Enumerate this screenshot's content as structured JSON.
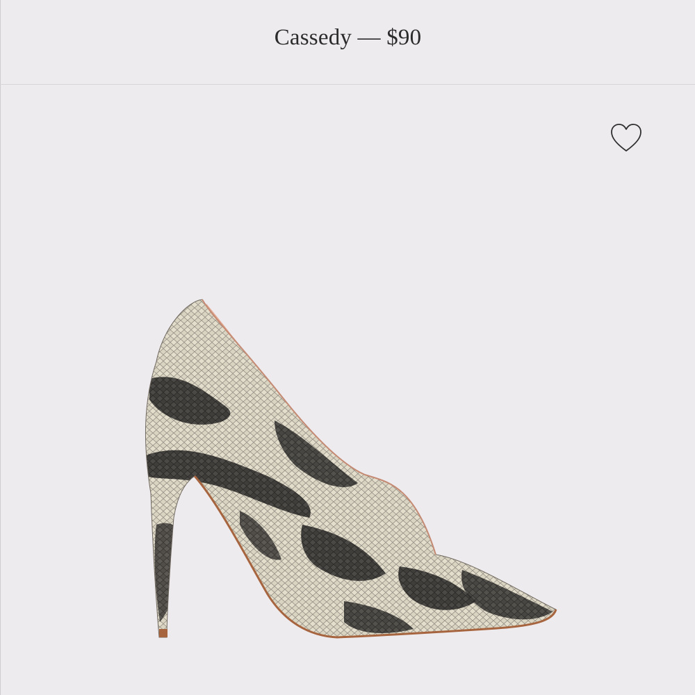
{
  "product": {
    "title": "Cassedy — $90"
  },
  "actions": {
    "favorite_icon": "heart-outline-icon"
  },
  "image": {
    "subject": "snakeskin-pointed-toe-stiletto-pump",
    "colors": {
      "base": "#d8d2bf",
      "scale_dark": "#2f2d2c",
      "lining": "#e2a991",
      "sole": "#a7653f"
    }
  }
}
